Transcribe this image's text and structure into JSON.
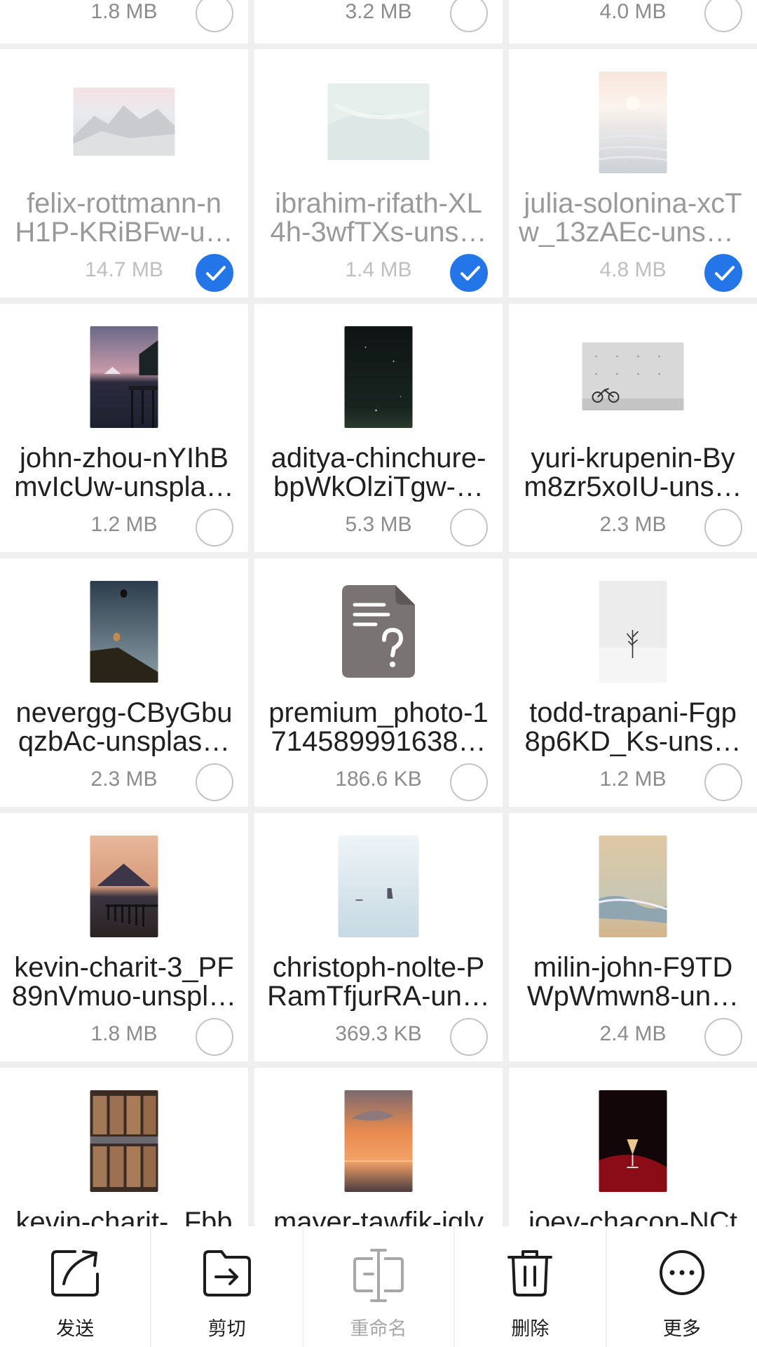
{
  "top_row": [
    {
      "size": "1.8 MB",
      "selected": false
    },
    {
      "size": "3.2 MB",
      "selected": false
    },
    {
      "size": "4.0 MB",
      "selected": false
    }
  ],
  "files": [
    {
      "line1": "felix-rottmann-n",
      "line2": "H1P-KRiBFw-u…",
      "size": "14.7 MB",
      "selected": true
    },
    {
      "line1": "ibrahim-rifath-XL",
      "line2": "4h-3wfTXs-uns…",
      "size": "1.4 MB",
      "selected": true
    },
    {
      "line1": "julia-solonina-xcT",
      "line2": "w_13zAEc-unsp…",
      "size": "4.8 MB",
      "selected": true
    },
    {
      "line1": "john-zhou-nYIhB",
      "line2": "mvIcUw-unspla…",
      "size": "1.2 MB",
      "selected": false
    },
    {
      "line1": "aditya-chinchure-",
      "line2": "bpWkOlziTgw-…",
      "size": "5.3 MB",
      "selected": false
    },
    {
      "line1": "yuri-krupenin-By",
      "line2": "m8zr5xoIU-uns…",
      "size": "2.3 MB",
      "selected": false
    },
    {
      "line1": "nevergg-CByGbu",
      "line2": "qzbAc-unsplas…",
      "size": "2.3 MB",
      "selected": false
    },
    {
      "line1": "premium_photo-1",
      "line2": "714589991638…",
      "size": "186.6 KB",
      "selected": false
    },
    {
      "line1": "todd-trapani-Fgp",
      "line2": "8p6KD_Ks-uns…",
      "size": "1.2 MB",
      "selected": false
    },
    {
      "line1": "kevin-charit-3_PF",
      "line2": "89nVmuo-unspl…",
      "size": "1.8 MB",
      "selected": false
    },
    {
      "line1": "christoph-nolte-P",
      "line2": "RamTfjurRA-un…",
      "size": "369.3 KB",
      "selected": false
    },
    {
      "line1": "milin-john-F9TD",
      "line2": "WpWmwn8-un…",
      "size": "2.4 MB",
      "selected": false
    },
    {
      "line1": "kevin-charit-_Fbb",
      "line2": "",
      "size": "",
      "selected": false
    },
    {
      "line1": "mayer-tawfik-iqlv",
      "line2": "",
      "size": "",
      "selected": false
    },
    {
      "line1": "joey-chacon-NCt",
      "line2": "",
      "size": "",
      "selected": false
    }
  ],
  "toolbar": {
    "send": "发送",
    "cut": "剪切",
    "rename": "重命名",
    "delete": "删除",
    "more": "更多"
  },
  "colors": {
    "accent": "#2476e8",
    "disabled": "#a8a8a8"
  }
}
